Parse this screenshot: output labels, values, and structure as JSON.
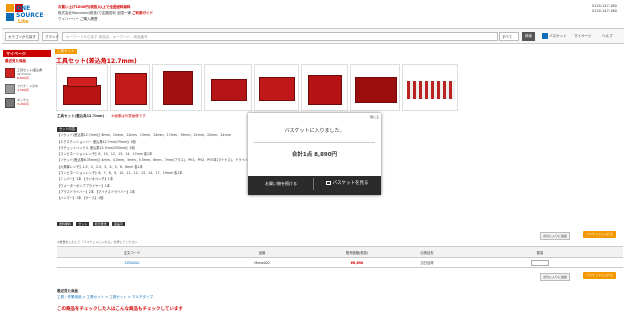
{
  "brand": {
    "line1": "ONE",
    "line2": "SOURCE",
    "line3": "Lite"
  },
  "header": {
    "info1": "お買い上げ1000円(税抜)以上で全国送料無料",
    "info2": "株式会社Monotaro(税抜)で定額送料 全国一律",
    "info3": "ウイハーリー ご購入履歴",
    "contact": "ご利用ガイド",
    "phone": "0120-147-160",
    "fax": "0120-147-160"
  },
  "nav": {
    "category_btn": "カテゴリから探す",
    "brand_btn": "ブランド",
    "search_placeholder": "キーワードから探す 商品名、キーワード、商品番号",
    "search_select": "すべて",
    "search_btn": "検索",
    "cart": "バスケット",
    "mypage": "マイページ",
    "help": "ヘルプ"
  },
  "sidebar": {
    "head": "マイページ",
    "sub": "最近見た商品",
    "items": [
      {
        "name": "工具セット(差込角 12.7mm)",
        "price": "8,890円"
      },
      {
        "name": "スパナ・メガネ",
        "price": "4,500円"
      },
      {
        "name": "ボックス",
        "price": "3,200円"
      }
    ]
  },
  "product": {
    "category": "工具セット",
    "title": "工具セット(差込角12.7mm)",
    "bar_title": "工具セット(差込角12.7mm)",
    "bar_note": "※画像は代表画像です",
    "spec_label": "セット内容",
    "specs": [
      "【ソケット(差込角12.7mm)】8mm、10mm、12mm、13mm、14mm、17mm、19mm、21mm、22mm、24mm",
      "【エクステンションバー 差込角12.7mm/75mm】1個",
      "【ラチェットハンドル 差込角12.7mm/250mm】1個",
      "【コンビネーションレンチ】8、10、12、13、14、17mm 各1本",
      "【ソケット(差込角6.35mm)】4mm、4.5mm、5mm、5.5mm、6mm、7mm(プラス)、PH1、PH2、PH3本(マイナス)、ドライバービット差込角6.35mm用各1本",
      "【六角棒レンチ】1.5、2、2.5、3、4、5、6、8mm 各1本",
      "【コンビネーションレンチ】6、7、8、9、10、11、12、13、14、17、19mm 各1本",
      "【ニッパー】1本 【ラジオペンチ】1本",
      "【ウォーターポンププライヤー】1本",
      "【プラスドライバー】2本 【マイナスドライバー】2本",
      "【ハンマー】1本 【ケース】1個"
    ],
    "tags": [
      "送料無料",
      "セット",
      "即日発送",
      "返品可"
    ]
  },
  "table": {
    "headers": [
      "注文コード",
      "品番",
      "販売価格(税抜)",
      "出荷目安",
      "数量"
    ],
    "rows": [
      [
        "ZZ00000",
        "Mono000",
        "¥8,890",
        "当日出荷",
        ""
      ]
    ],
    "note": "※数量を入力して「バスケットに入れる」を押してください",
    "fav_btn": "お気に入りに追加",
    "cart_btn": "バスケットに入れる"
  },
  "recent": "最近見た商品",
  "breadcrumb": "工具／作業用品 > 工具セット > 工具セット > マルチタイプ",
  "promo": "この商品をチェックした人はこんな商品もチェックしています",
  "modal": {
    "close": "閉じる",
    "message": "バスケットに入りました。",
    "total": "合計1点 8,890円",
    "continue": "お買い物を続ける",
    "view_cart": "バスケットを見る"
  }
}
